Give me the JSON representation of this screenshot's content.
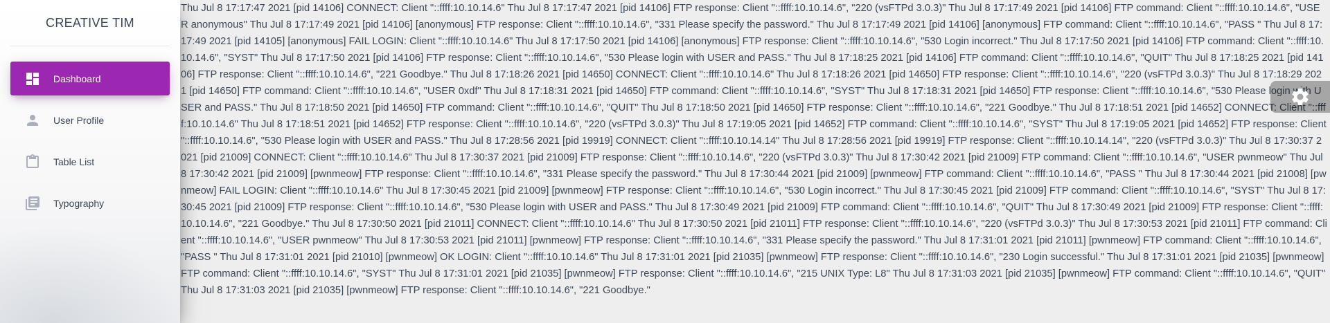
{
  "sidebar": {
    "brand": "Creative Tim",
    "items": [
      {
        "label": "Dashboard",
        "icon": "dashboard-icon",
        "active": true
      },
      {
        "label": "User Profile",
        "icon": "person-icon",
        "active": false
      },
      {
        "label": "Table List",
        "icon": "clipboard-icon",
        "active": false
      },
      {
        "label": "Typography",
        "icon": "library-books-icon",
        "active": false
      }
    ]
  },
  "main": {
    "log_text": "Thu Jul 8 17:17:47 2021 [pid 14106] CONNECT: Client \"::ffff:10.10.14.6\" Thu Jul 8 17:17:47 2021 [pid 14106] FTP response: Client \"::ffff:10.10.14.6\", \"220 (vsFTPd 3.0.3)\" Thu Jul 8 17:17:49 2021 [pid 14106] FTP command: Client \"::ffff:10.10.14.6\", \"USER anonymous\" Thu Jul 8 17:17:49 2021 [pid 14106] [anonymous] FTP response: Client \"::ffff:10.10.14.6\", \"331 Please specify the password.\" Thu Jul 8 17:17:49 2021 [pid 14106] [anonymous] FTP command: Client \"::ffff:10.10.14.6\", \"PASS \" Thu Jul 8 17:17:49 2021 [pid 14105] [anonymous] FAIL LOGIN: Client \"::ffff:10.10.14.6\" Thu Jul 8 17:17:50 2021 [pid 14106] [anonymous] FTP response: Client \"::ffff:10.10.14.6\", \"530 Login incorrect.\" Thu Jul 8 17:17:50 2021 [pid 14106] FTP command: Client \"::ffff:10.10.14.6\", \"SYST\" Thu Jul 8 17:17:50 2021 [pid 14106] FTP response: Client \"::ffff:10.10.14.6\", \"530 Please login with USER and PASS.\" Thu Jul 8 17:18:25 2021 [pid 14106] FTP command: Client \"::ffff:10.10.14.6\", \"QUIT\" Thu Jul 8 17:18:25 2021 [pid 14106] FTP response: Client \"::ffff:10.10.14.6\", \"221 Goodbye.\" Thu Jul 8 17:18:26 2021 [pid 14650] CONNECT: Client \"::ffff:10.10.14.6\" Thu Jul 8 17:18:26 2021 [pid 14650] FTP response: Client \"::ffff:10.10.14.6\", \"220 (vsFTPd 3.0.3)\" Thu Jul 8 17:18:29 2021 [pid 14650] FTP command: Client \"::ffff:10.10.14.6\", \"USER 0xdf\" Thu Jul 8 17:18:31 2021 [pid 14650] FTP command: Client \"::ffff:10.10.14.6\", \"SYST\" Thu Jul 8 17:18:31 2021 [pid 14650] FTP response: Client \"::ffff:10.10.14.6\", \"530 Please login with USER and PASS.\" Thu Jul 8 17:18:50 2021 [pid 14650] FTP command: Client \"::ffff:10.10.14.6\", \"QUIT\" Thu Jul 8 17:18:50 2021 [pid 14650] FTP response: Client \"::ffff:10.10.14.6\", \"221 Goodbye.\" Thu Jul 8 17:18:51 2021 [pid 14652] CONNECT: Client \"::ffff:10.10.14.6\" Thu Jul 8 17:18:51 2021 [pid 14652] FTP response: Client \"::ffff:10.10.14.6\", \"220 (vsFTPd 3.0.3)\" Thu Jul 8 17:19:05 2021 [pid 14652] FTP command: Client \"::ffff:10.10.14.6\", \"SYST\" Thu Jul 8 17:19:05 2021 [pid 14652] FTP response: Client \"::ffff:10.10.14.6\", \"530 Please login with USER and PASS.\" Thu Jul 8 17:28:56 2021 [pid 19919] CONNECT: Client \"::ffff:10.10.14.14\" Thu Jul 8 17:28:56 2021 [pid 19919] FTP response: Client \"::ffff:10.10.14.14\", \"220 (vsFTPd 3.0.3)\" Thu Jul 8 17:30:37 2021 [pid 21009] CONNECT: Client \"::ffff:10.10.14.6\" Thu Jul 8 17:30:37 2021 [pid 21009] FTP response: Client \"::ffff:10.10.14.6\", \"220 (vsFTPd 3.0.3)\" Thu Jul 8 17:30:42 2021 [pid 21009] FTP command: Client \"::ffff:10.10.14.6\", \"USER pwnmeow\" Thu Jul 8 17:30:42 2021 [pid 21009] [pwnmeow] FTP response: Client \"::ffff:10.10.14.6\", \"331 Please specify the password.\" Thu Jul 8 17:30:44 2021 [pid 21009] [pwnmeow] FTP command: Client \"::ffff:10.10.14.6\", \"PASS \" Thu Jul 8 17:30:44 2021 [pid 21008] [pwnmeow] FAIL LOGIN: Client \"::ffff:10.10.14.6\" Thu Jul 8 17:30:45 2021 [pid 21009] [pwnmeow] FTP response: Client \"::ffff:10.10.14.6\", \"530 Login incorrect.\" Thu Jul 8 17:30:45 2021 [pid 21009] FTP command: Client \"::ffff:10.10.14.6\", \"SYST\" Thu Jul 8 17:30:45 2021 [pid 21009] FTP response: Client \"::ffff:10.10.14.6\", \"530 Please login with USER and PASS.\" Thu Jul 8 17:30:49 2021 [pid 21009] FTP command: Client \"::ffff:10.10.14.6\", \"QUIT\" Thu Jul 8 17:30:49 2021 [pid 21009] FTP response: Client \"::ffff:10.10.14.6\", \"221 Goodbye.\" Thu Jul 8 17:30:50 2021 [pid 21011] CONNECT: Client \"::ffff:10.10.14.6\" Thu Jul 8 17:30:50 2021 [pid 21011] FTP response: Client \"::ffff:10.10.14.6\", \"220 (vsFTPd 3.0.3)\" Thu Jul 8 17:30:53 2021 [pid 21011] FTP command: Client \"::ffff:10.10.14.6\", \"USER pwnmeow\" Thu Jul 8 17:30:53 2021 [pid 21011] [pwnmeow] FTP response: Client \"::ffff:10.10.14.6\", \"331 Please specify the password.\" Thu Jul 8 17:31:01 2021 [pid 21011] [pwnmeow] FTP command: Client \"::ffff:10.10.14.6\", \"PASS \" Thu Jul 8 17:31:01 2021 [pid 21010] [pwnmeow] OK LOGIN: Client \"::ffff:10.10.14.6\" Thu Jul 8 17:31:01 2021 [pid 21035] [pwnmeow] FTP response: Client \"::ffff:10.10.14.6\", \"230 Login successful.\" Thu Jul 8 17:31:01 2021 [pid 21035] [pwnmeow] FTP command: Client \"::ffff:10.10.14.6\", \"SYST\" Thu Jul 8 17:31:01 2021 [pid 21035] [pwnmeow] FTP response: Client \"::ffff:10.10.14.6\", \"215 UNIX Type: L8\" Thu Jul 8 17:31:03 2021 [pid 21035] [pwnmeow] FTP command: Client \"::ffff:10.10.14.6\", \"QUIT\" Thu Jul 8 17:31:03 2021 [pid 21035] [pwnmeow] FTP response: Client \"::ffff:10.10.14.6\", \"221 Goodbye.\""
  },
  "fixed_plugin": {
    "icon": "settings-gear-icon"
  },
  "colors": {
    "accent": "#9c27b0",
    "text": "#3c4858",
    "background": "#eeeeee"
  }
}
